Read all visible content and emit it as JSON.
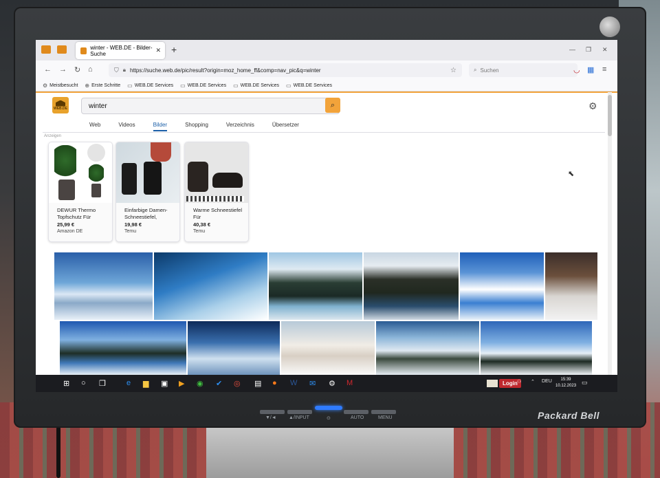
{
  "browser": {
    "tabs": [
      {
        "title": "winter - WEB.DE - Bilder-Suche"
      }
    ],
    "address": "https://suche.web.de/pic/result?origin=moz_home_ff&comp=nav_pic&q=winter",
    "search_placeholder": "Suchen",
    "bookmarks": [
      "Meistbesucht",
      "Erste Schritte",
      "WEB.DE Services",
      "WEB.DE Services",
      "WEB.DE Services",
      "WEB.DE Services"
    ]
  },
  "page": {
    "logo_text": "WEB.DE",
    "query": "winter",
    "nav_tabs": [
      "Web",
      "Videos",
      "Bilder",
      "Shopping",
      "Verzeichnis",
      "Übersetzer"
    ],
    "active_tab": "Bilder",
    "ads_label": "Anzeigen",
    "ads": [
      {
        "title": "DEWUR Thermo Topfschutz Für",
        "price": "25,99 €",
        "shop": "Amazon DE"
      },
      {
        "title": "Einfarbige Damen-Schneestiefel,",
        "price": "19,98 €",
        "shop": "Temu"
      },
      {
        "title": "Warme Schneestiefel Für",
        "price": "40,38 €",
        "shop": "Temu"
      }
    ]
  },
  "taskbar": {
    "login_label": "Login",
    "language": "DEU",
    "time": "15:39",
    "date": "10.12.2023"
  },
  "monitor": {
    "brand": "Packard Bell",
    "buttons": [
      "▼/◄",
      "▲/INPUT",
      "⊙",
      "AUTO",
      "MENU"
    ]
  },
  "colors": {
    "accent": "#f2a33a",
    "active_tab": "#1b5fa8",
    "login": "#c0282e"
  }
}
